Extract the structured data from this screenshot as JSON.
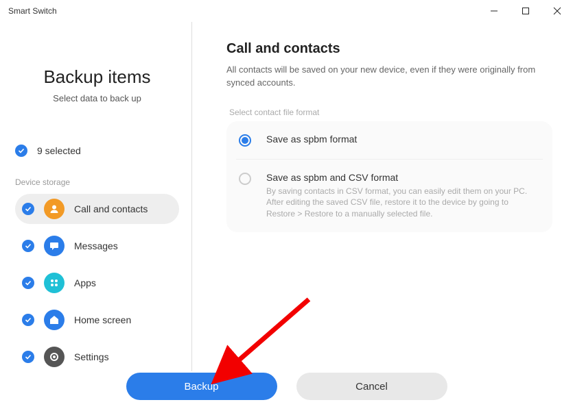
{
  "window": {
    "title": "Smart Switch"
  },
  "sidebar": {
    "title": "Backup items",
    "subtitle": "Select data to back up",
    "selected_count": "9 selected",
    "storage_label": "Device storage",
    "items": [
      {
        "label": "Call and contacts"
      },
      {
        "label": "Messages"
      },
      {
        "label": "Apps"
      },
      {
        "label": "Home screen"
      },
      {
        "label": "Settings"
      }
    ]
  },
  "main": {
    "title": "Call and contacts",
    "description": "All contacts will be saved on your new device, even if they were originally from synced accounts.",
    "format_label": "Select contact file format",
    "options": [
      {
        "title": "Save as spbm format",
        "description": ""
      },
      {
        "title": "Save as spbm and CSV format",
        "description": "By saving contacts in CSV format, you can easily edit them on your PC. After editing the saved CSV file, restore it to the device by going to Restore > Restore to a manually selected file."
      }
    ]
  },
  "footer": {
    "backup_label": "Backup",
    "cancel_label": "Cancel"
  }
}
